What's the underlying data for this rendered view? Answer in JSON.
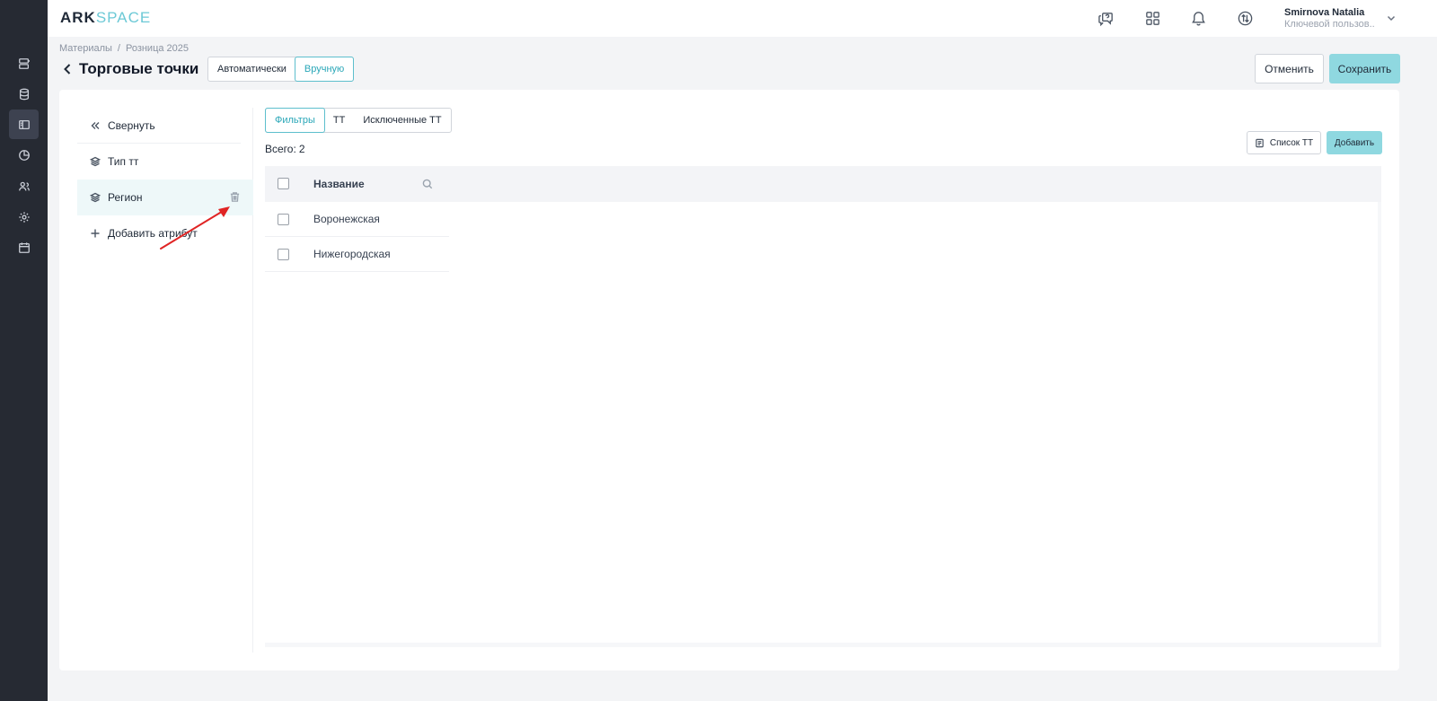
{
  "app": {
    "logo_ark": "ARK",
    "logo_space": "SPACE"
  },
  "user": {
    "name": "Smirnova Natalia",
    "role": "Ключевой пользов..."
  },
  "breadcrumb": {
    "items": [
      "Материалы",
      "Розница 2025"
    ],
    "separator": "/"
  },
  "page": {
    "title": "Торговые точки"
  },
  "mode": {
    "auto": "Автоматически",
    "manual": "Вручную",
    "selected": "Вручную"
  },
  "actions": {
    "cancel": "Отменить",
    "save": "Сохранить"
  },
  "sidebar": {
    "collapse": "Свернуть",
    "items": [
      {
        "label": "Тип тт",
        "icon": "layers-icon"
      },
      {
        "label": "Регион",
        "icon": "layers-icon",
        "selected": true
      }
    ],
    "add": "Добавить атрибут"
  },
  "tabs": {
    "items": [
      "Фильтры",
      "ТТ",
      "Исключенные ТТ"
    ],
    "active": "Фильтры"
  },
  "summary": {
    "label": "Всего:",
    "count": "2"
  },
  "toolbar": {
    "list": "Список ТТ",
    "add": "Добавить"
  },
  "table": {
    "header": "Название",
    "rows": [
      "Воронежская",
      "Нижегородская"
    ]
  },
  "colors": {
    "accent": "#5dbfcd",
    "button_primary": "#8fd8e0",
    "rail": "#262a33",
    "annotation": "#e02424"
  }
}
